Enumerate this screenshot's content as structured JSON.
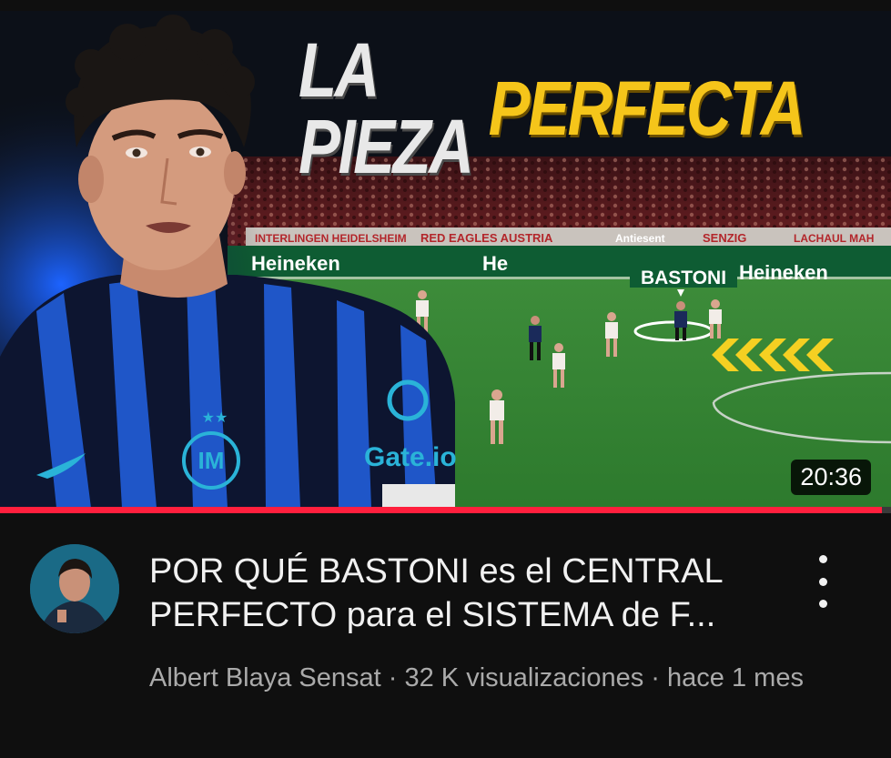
{
  "thumbnail": {
    "title_white": "LA PIEZA",
    "title_yellow": "PERFECTA",
    "player_tag": "BASTONI",
    "duration": "20:36",
    "ad_boards": [
      "Heineken",
      "He",
      "Heineken"
    ],
    "shirt_sponsor": "Gate.io",
    "banners": [
      "INTERLINGEN HEIDELSHEIM",
      "RED EAGLES AUSTRIA",
      "Antiesent",
      "SENZIG",
      "LACHAUL MAH"
    ]
  },
  "progress": {
    "fraction": 0.99
  },
  "video": {
    "title_line1": "POR QUÉ BASTONI es el CENTRAL",
    "title_line2": "PERFECTO para el SISTEMA de F...",
    "channel": "Albert Blaya Sensat",
    "separator": " · ",
    "views": "32 K visualizaciones",
    "age": "hace 1 mes"
  },
  "colors": {
    "background": "#0f0f0f",
    "title_yellow": "#f5c51a",
    "progress_red": "#ff1f3d",
    "secondary_text": "#aaaaaa",
    "inter_blue": "#1f56c8"
  },
  "icons": {
    "menu": "more-vert-icon"
  }
}
